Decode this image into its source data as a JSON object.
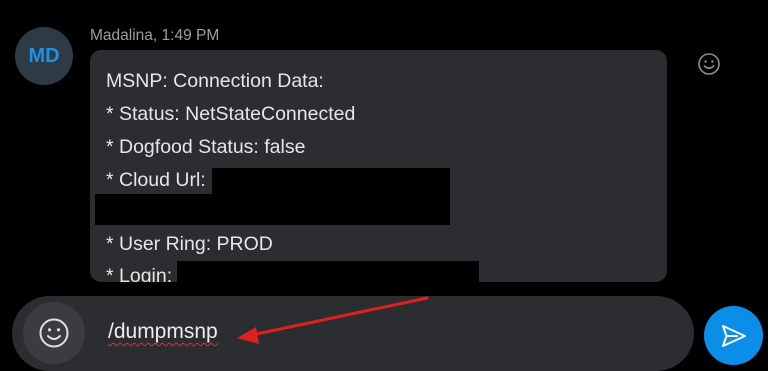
{
  "message": {
    "avatar_initials": "MD",
    "sender": "Madalina",
    "time": "1:49 PM",
    "lines": [
      "MSNP: Connection Data:",
      "* Status: NetStateConnected",
      "* Dogfood Status: false",
      "* Cloud Url:",
      "* User Ring: PROD",
      "* Login:"
    ]
  },
  "composer": {
    "input_value": "/dumpmsnp"
  },
  "colors": {
    "accent": "#0a8ee8",
    "annotation_arrow": "#e02020",
    "bubble": "#2b2d31",
    "background": "#000000"
  },
  "icons": {
    "react": "smiley-icon",
    "emoji": "smiley-icon",
    "send": "paper-plane-icon"
  }
}
